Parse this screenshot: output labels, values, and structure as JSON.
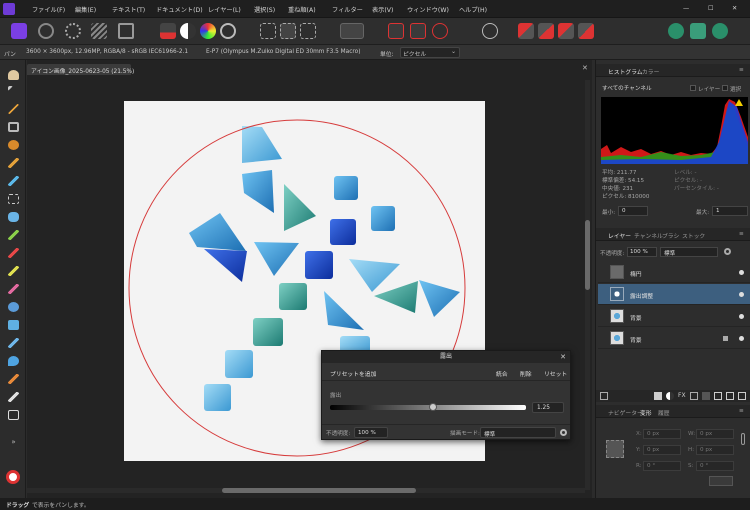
{
  "menu": [
    "ファイル(F)",
    "編集(E)",
    "テキスト(T)",
    "ドキュメント(D)",
    "レイヤー(L)",
    "選択(S)",
    "重ね順(A)",
    "フィルター",
    "表示(V)",
    "ウィンドウ(W)",
    "ヘルプ(H)"
  ],
  "context_bar": {
    "tool": "パン",
    "doc_info": "3600 × 3600px, 12.96MP, RGBA/8 - sRGB IEC61966-2.1",
    "camera": "E-P7 (Olympus M.Zuiko Digital ED 30mm F3.5 Macro)",
    "unit_label": "単位:",
    "unit_value": "ピクセル"
  },
  "document": {
    "tab": "アイコン画像_2025-0623-05 (21.5%)"
  },
  "status": {
    "bold": "ドラッグ",
    "rest": "で表示をパンします。"
  },
  "histogram": {
    "tabs": [
      "ヒストグラム",
      "カラー"
    ],
    "channel": "すべてのチャンネル",
    "layer_label": "レイヤー",
    "selection_label": "選択",
    "stats": [
      {
        "label": "平均: 211.77",
        "value": ""
      },
      {
        "label": "標準偏差: 54.15",
        "value": ""
      },
      {
        "label": "中央値: 231",
        "value": ""
      },
      {
        "label": "ピクセル: 810000",
        "value": ""
      }
    ],
    "stats_right": [
      "レベル: -",
      "ピクセル: -",
      "パーセンタイル: -"
    ],
    "min_label": "最小:",
    "min_value": "0",
    "max_label": "最大:",
    "max_value": "1"
  },
  "layers_panel": {
    "tabs": [
      "レイヤー",
      "チャンネル",
      "ブラシ",
      "ストック"
    ],
    "opacity_label": "不透明度:",
    "opacity_value": "100 %",
    "blend": "標準",
    "layers": [
      {
        "name": "楕円",
        "selected": false
      },
      {
        "name": "露出調整",
        "selected": true
      },
      {
        "name": "背景",
        "selected": false
      },
      {
        "name": "背景",
        "selected": false
      }
    ]
  },
  "transform_panel": {
    "tabs": [
      "ナビゲーター",
      "変形",
      "履歴"
    ],
    "fields": [
      {
        "axis": "X:",
        "value": "0 px"
      },
      {
        "axis": "W:",
        "value": "0 px"
      },
      {
        "axis": "Y:",
        "value": "0 px"
      },
      {
        "axis": "H:",
        "value": "0 px"
      },
      {
        "axis": "R:",
        "value": "0 °"
      },
      {
        "axis": "S:",
        "value": "0 °"
      }
    ]
  },
  "exposure_dialog": {
    "title": "露出",
    "add_preset": "プリセットを追加",
    "merge": "統合",
    "delete": "削除",
    "reset": "リセット",
    "param_label": "露出",
    "value": "1.25",
    "slider_fraction": 0.525,
    "opacity_label": "不透明度:",
    "opacity_value": "100 %",
    "blend_label": "描画モード:",
    "blend_value": "標準"
  },
  "colors": {
    "accent": "#7b3fe4",
    "selection": "#3d5f7f",
    "ellipse": "#d63b3b"
  }
}
